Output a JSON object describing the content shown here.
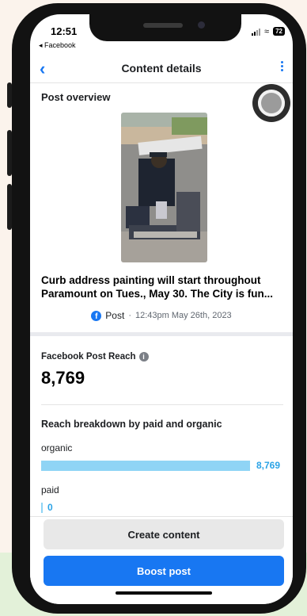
{
  "status_bar": {
    "time": "12:51",
    "back_app": "◂ Facebook",
    "battery": "72"
  },
  "header": {
    "back_icon": "chevron-left-icon",
    "title": "Content details",
    "menu_icon": "kebab-menu-icon"
  },
  "post_overview": {
    "section_title": "Post overview",
    "headline": "Curb address painting will start throughout Paramount on Tues., May 30. The City is fun...",
    "type_label": "Post",
    "separator": "·",
    "timestamp": "12:43pm May 26th, 2023"
  },
  "reach": {
    "label": "Facebook Post Reach",
    "value": "8,769",
    "breakdown_title": "Reach breakdown by paid and organic",
    "rows": [
      {
        "label": "organic",
        "value": "8,769",
        "fraction": 1.0
      },
      {
        "label": "paid",
        "value": "0",
        "fraction": 0
      }
    ]
  },
  "actions": {
    "secondary": "Create content",
    "primary": "Boost post"
  },
  "colors": {
    "accent": "#1877f2",
    "bar": "#8fd4f5",
    "bar_value": "#2ba3e6"
  }
}
